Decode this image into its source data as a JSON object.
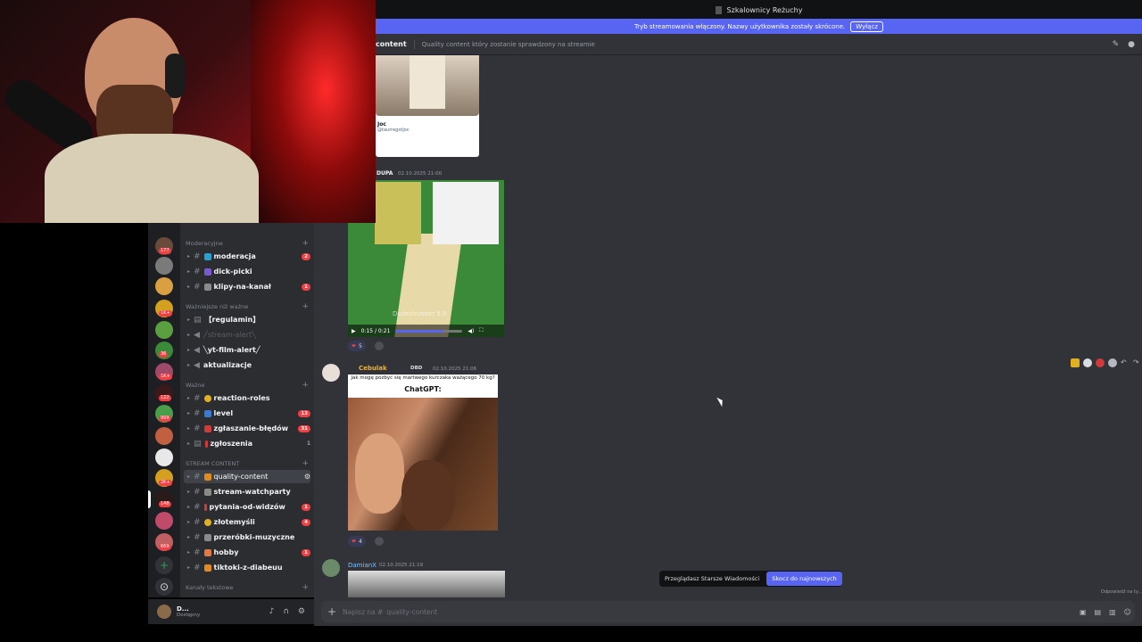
{
  "window": {
    "title": "Szkalownicy Reżuchy"
  },
  "stream_bar": {
    "text": "Tryb streamowania włączony. Nazwy użytkownika zostały skrócone.",
    "button": "Wyłącz"
  },
  "header": {
    "channel": "content",
    "topic": "Quality content który zostanie sprawdzony na streamie"
  },
  "categories": {
    "moderacyjne": "Moderacyjne",
    "wazniejsze": "Ważniejsze niż ważne",
    "wazne": "Ważne",
    "stream": "STREAM CONTENT",
    "tekstowe": "Kanały tekstowe"
  },
  "channels": [
    {
      "name": "moderacja",
      "badge": "2"
    },
    {
      "name": "dick-picki",
      "badge": ""
    },
    {
      "name": "klipy-na-kanał",
      "badge": "1"
    },
    {
      "name": "【regulamin】",
      "badge": ""
    },
    {
      "name": "╱stream-alert╲",
      "badge": ""
    },
    {
      "name": "╲yt-film-alert╱",
      "badge": ""
    },
    {
      "name": "aktualizacje",
      "badge": ""
    },
    {
      "name": "reaction-roles",
      "badge": ""
    },
    {
      "name": "level",
      "badge": "13"
    },
    {
      "name": "zgłaszanie-błędów",
      "badge": "31"
    },
    {
      "name": "zgłoszenia",
      "badge": "1"
    },
    {
      "name": "quality-content",
      "badge": ""
    },
    {
      "name": "stream-watchparty",
      "badge": ""
    },
    {
      "name": "pytania-od-widzów",
      "badge": "1"
    },
    {
      "name": "złotemyśli",
      "badge": "4"
    },
    {
      "name": "przeróbki-muzyczne",
      "badge": ""
    },
    {
      "name": "hobby",
      "badge": "1"
    },
    {
      "name": "tiktoki-z-diabeuu",
      "badge": ""
    }
  ],
  "server_badges": [
    "1",
    "177",
    "1K+",
    "1K+",
    "36",
    "1K+",
    "122",
    "999",
    "2K+",
    "148",
    "669"
  ],
  "user": {
    "name": "D...",
    "status": "Dostępny"
  },
  "messages": {
    "tweet": {
      "name": "Joc",
      "handle": "@taurregotjoc"
    },
    "dupa": {
      "author": "DUPA",
      "time": "02.10.2025 21:00"
    },
    "video": {
      "time": "0:15 / 0:21",
      "subtitle": "Dudeshunder 5.0",
      "progress": 0.71,
      "reaction_count": "5"
    },
    "cebulak": {
      "author": "Cebulak",
      "tag": "DBD",
      "time": "02.10.2025 21:06",
      "question": "Jak mogę pozbyć się martwego kurczaka ważącego 70 kg?",
      "title": "ChatGPT:",
      "reaction_count": "4"
    },
    "damian": {
      "author": "DamianX",
      "time": "02.10.2025 21:19"
    }
  },
  "older": {
    "text": "Przeglądasz Starsze Wiadomości",
    "jump": "Skocz do najnowszych"
  },
  "viewers": "Odpowiedź na ty...",
  "composer": {
    "placeholder": "Napisz na #",
    "channel": "quality-content"
  },
  "colors": {
    "accent": "#5865f2",
    "danger": "#f23f43",
    "bg": "#313338",
    "sidebar": "#2b2d31"
  }
}
